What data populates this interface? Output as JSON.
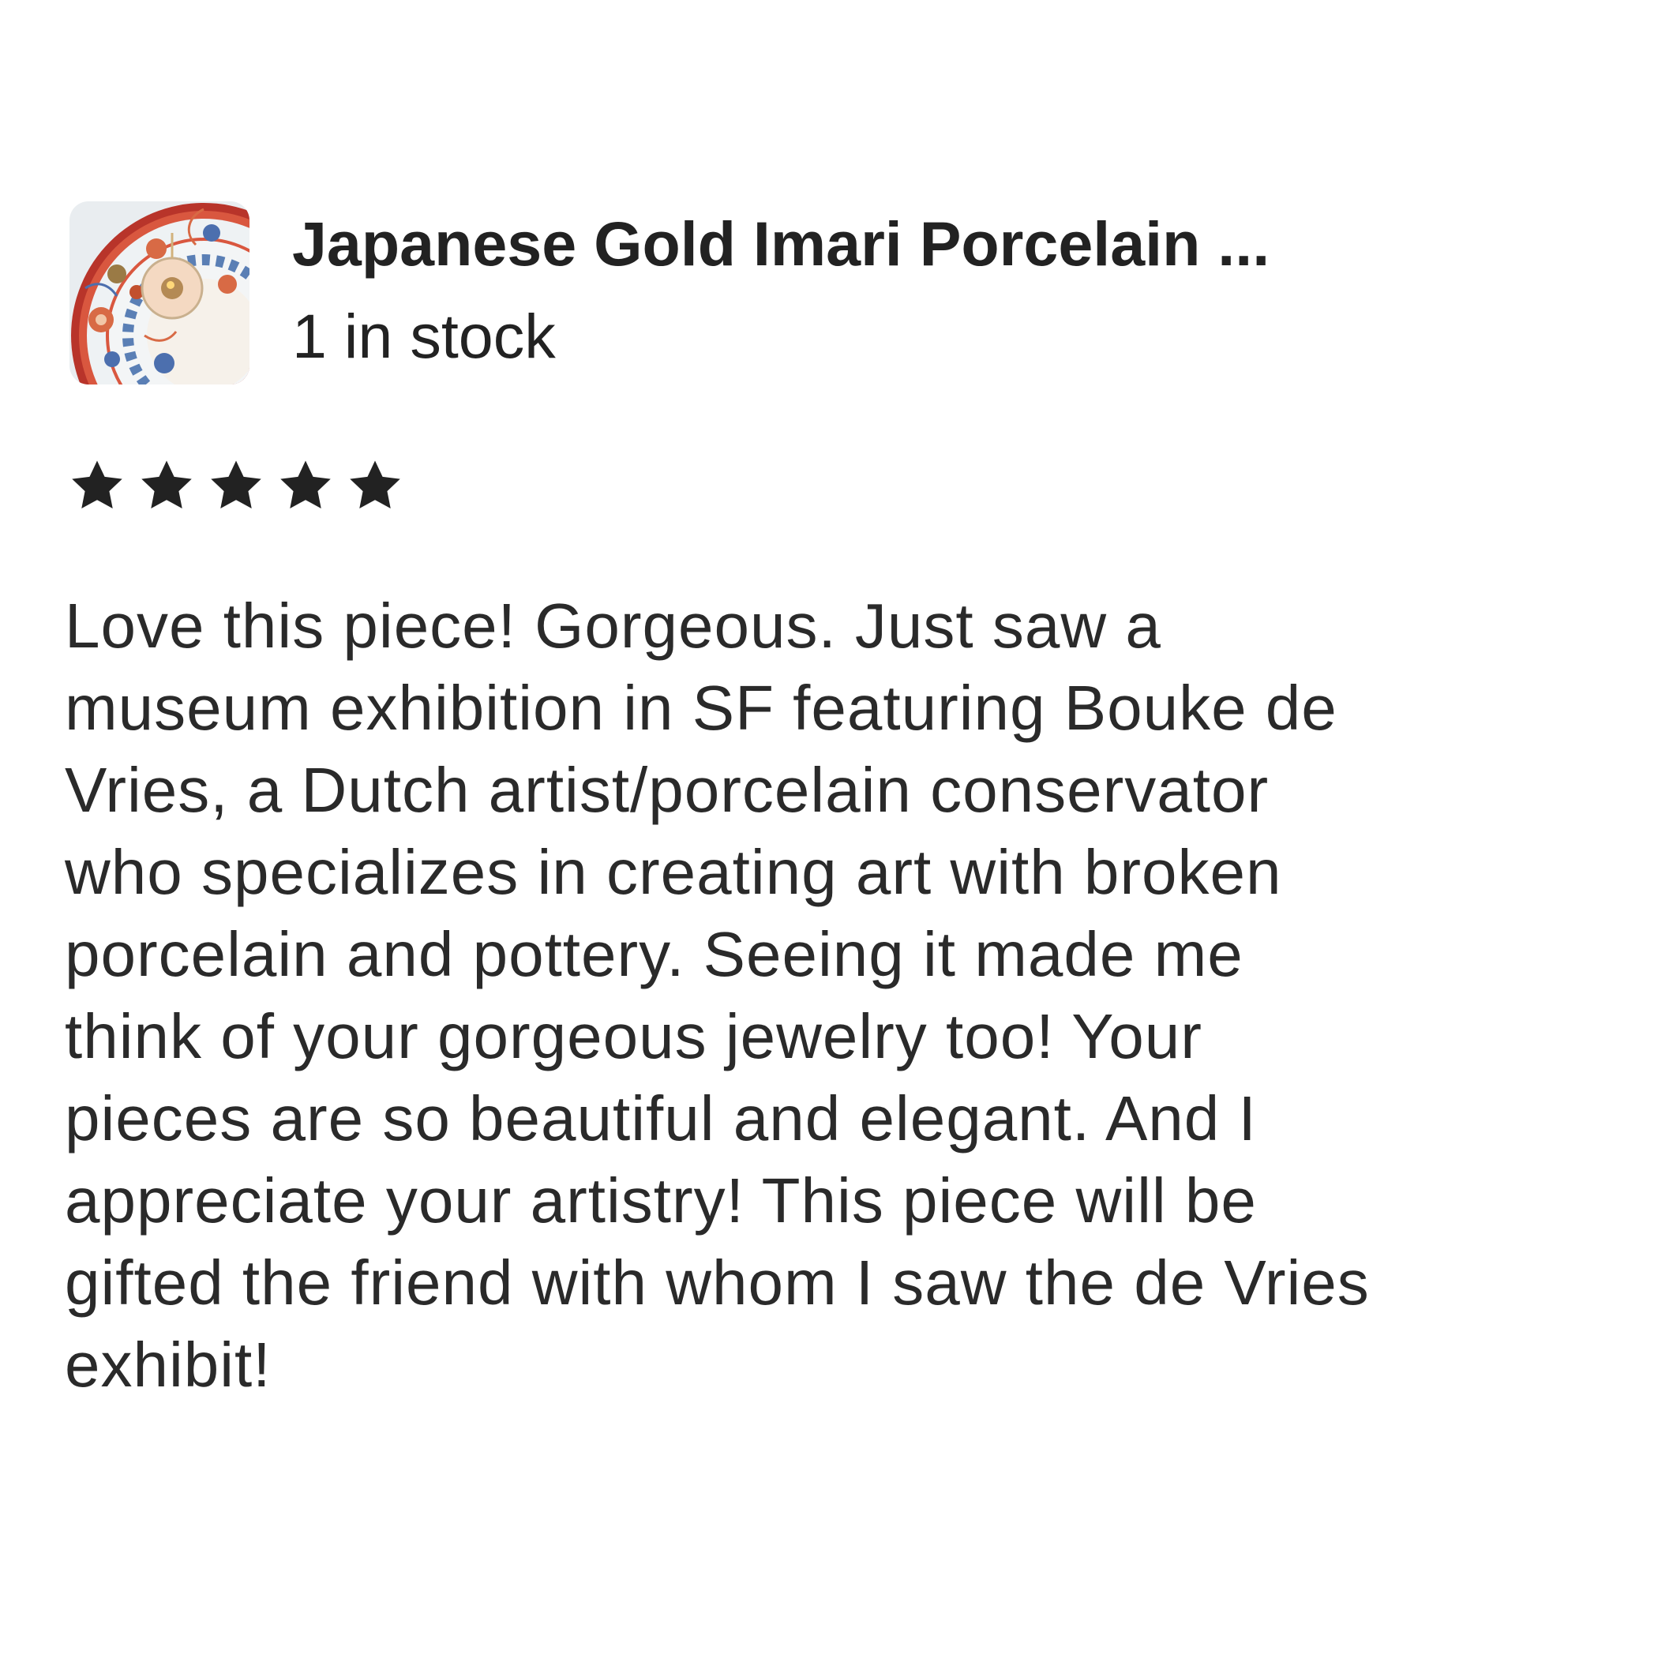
{
  "product": {
    "title": "Japanese Gold Imari Porcelain ...",
    "stock": "1 in stock",
    "thumbnail_icon": "porcelain-plate-thumbnail"
  },
  "rating": {
    "stars": 5,
    "max": 5,
    "color": "#222222"
  },
  "review": {
    "text": "Love this piece! Gorgeous. Just saw a\nmuseum exhibition in SF featuring Bouke de\nVries, a Dutch artist/porcelain conservator\nwho specializes in creating art with broken\nporcelain and pottery. Seeing it made me\nthink of your gorgeous jewelry too! Your\npieces are so beautiful and elegant. And I\nappreciate your artistry! This piece will be\ngifted the friend with whom I saw the de Vries\nexhibit!"
  }
}
